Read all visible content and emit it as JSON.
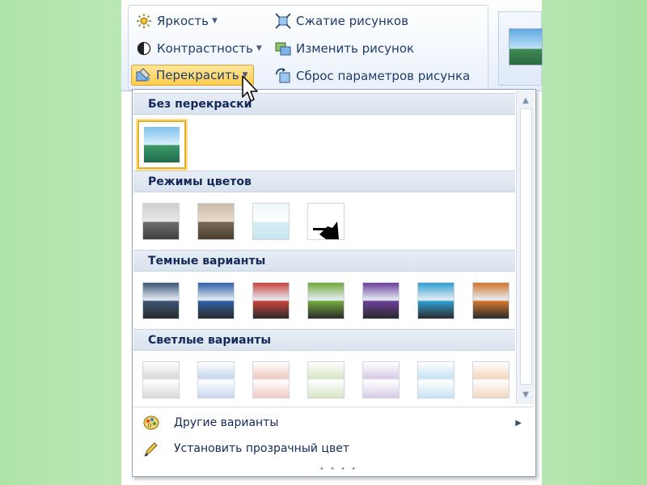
{
  "ribbon": {
    "brightness_label": "Яркость",
    "contrast_label": "Контрастность",
    "recolor_label": "Перекрасить",
    "compress_label": "Сжатие рисунков",
    "change_label": "Изменить рисунок",
    "reset_label": "Сброс параметров рисунка"
  },
  "gallery": {
    "sections": {
      "no_recolor": "Без перекраски",
      "color_modes": "Режимы цветов",
      "dark_variants": "Темные варианты",
      "light_variants": "Светлые варианты"
    },
    "dark_colors": [
      "#3c5474",
      "#2f5fa8",
      "#c9433c",
      "#73a83a",
      "#6b3f9a",
      "#2f9fd1",
      "#d0762c"
    ],
    "light_colors": [
      "#d9d9d9",
      "#c8d7ee",
      "#f0c9c2",
      "#d7e5c6",
      "#d6cbe5",
      "#c6e3f2",
      "#f2d6bd"
    ]
  },
  "menu": {
    "more_variants_label": "Другие варианты",
    "set_transparent_label": "Установить прозрачный цвет"
  },
  "icons": [
    "brightness-icon",
    "contrast-icon",
    "recolor-icon",
    "compress-icon",
    "change-picture-icon",
    "reset-icon",
    "palette-icon",
    "pen-icon",
    "cursor-icon"
  ]
}
